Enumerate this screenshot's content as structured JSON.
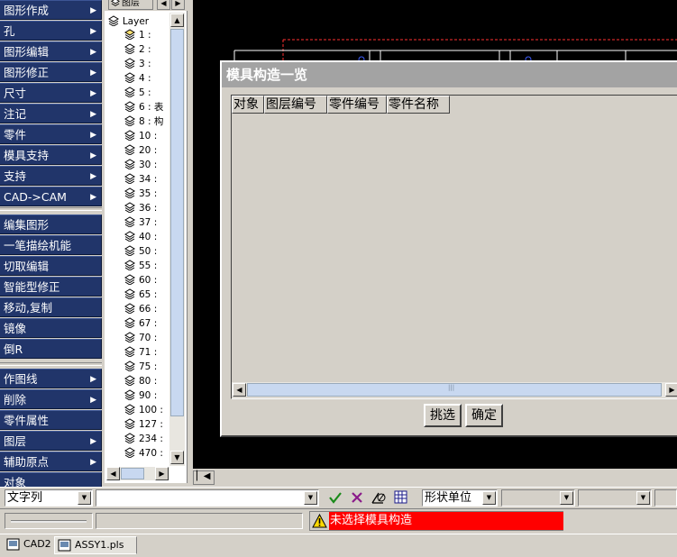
{
  "left_menu": {
    "group1": [
      {
        "label": "图形作成",
        "arrow": "▶"
      },
      {
        "label": "孔",
        "arrow": "▶"
      },
      {
        "label": "图形编辑",
        "arrow": "▶"
      },
      {
        "label": "图形修正",
        "arrow": "▶"
      },
      {
        "label": "尺寸",
        "arrow": "▶"
      },
      {
        "label": "注记",
        "arrow": "▶"
      },
      {
        "label": "零件",
        "arrow": "▶"
      },
      {
        "label": "模具支持",
        "arrow": "▶"
      },
      {
        "label": "支持",
        "arrow": "▶"
      },
      {
        "label": "CAD->CAM",
        "arrow": "▶"
      }
    ],
    "group2": [
      {
        "label": "编集图形"
      },
      {
        "label": "一笔描绘机能"
      },
      {
        "label": "切取编辑"
      },
      {
        "label": "智能型修正"
      },
      {
        "label": "移动,复制"
      },
      {
        "label": "镜像"
      },
      {
        "label": "倒R"
      }
    ],
    "group3": [
      {
        "label": "作图线",
        "arrow": "▶"
      },
      {
        "label": "削除",
        "arrow": "▶"
      },
      {
        "label": "零件属性"
      },
      {
        "label": "图层",
        "arrow": "▶"
      },
      {
        "label": "辅助原点",
        "arrow": "▶"
      },
      {
        "label": "对象"
      }
    ]
  },
  "layer_panel": {
    "tab_label": "图层",
    "root_label": "Layer",
    "layers": [
      "1 :",
      "2 :",
      "3 :",
      "4 :",
      "5 :",
      "6 : 表",
      "8 : 构",
      "10 :",
      "20 :",
      "30 :",
      "34 :",
      "35 :",
      "36 :",
      "37 :",
      "40 :",
      "50 :",
      "55 :",
      "60 :",
      "65 :",
      "66 :",
      "67 :",
      "70 :",
      "71 :",
      "75 :",
      "80 :",
      "90 :",
      "100 :",
      "127 :",
      "234 :",
      "470 :"
    ]
  },
  "dialog": {
    "title": "模具构造一览",
    "columns": [
      "对象",
      "图层编号",
      "零件编号",
      "零件名称"
    ],
    "rows": [],
    "select_button": "挑选",
    "ok_button": "确定"
  },
  "bottom_toolbar": {
    "text_mode": "文字列",
    "input_value": "",
    "unit_mode": "形状单位",
    "icons": [
      "check-icon",
      "cross-icon",
      "angle-icon",
      "grid-icon"
    ]
  },
  "status": {
    "message": "未选择模具构造",
    "message_bg": "#ff0000"
  },
  "taskbar": {
    "items": [
      "CAD2",
      "ASSY1.pls"
    ]
  },
  "colors": {
    "menu_bg": "#21356a",
    "canvas_bg": "#000000",
    "dialog_title_bg": "#a3a3a3"
  }
}
